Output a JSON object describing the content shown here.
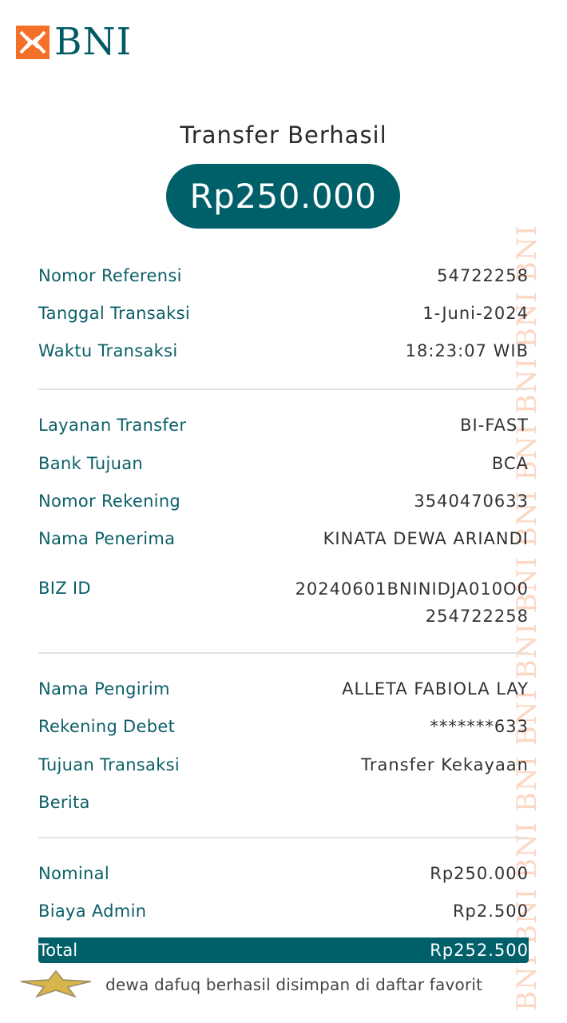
{
  "header": {
    "logo_text": "BNI"
  },
  "watermark": {
    "text": "BNI BNI BNI BNI BNI BNI BNI BNI BNI BNI BNI BNI"
  },
  "title": "Transfer Berhasil",
  "amount": "Rp250.000",
  "sections": {
    "transaction": [
      {
        "label": "Nomor Referensi",
        "value": "54722258"
      },
      {
        "label": "Tanggal Transaksi",
        "value": "1-Juni-2024"
      },
      {
        "label": "Waktu Transaksi",
        "value": "18:23:07 WIB"
      }
    ],
    "recipient": [
      {
        "label": "Layanan Transfer",
        "value": "BI-FAST"
      },
      {
        "label": "Bank Tujuan",
        "value": "BCA"
      },
      {
        "label": "Nomor Rekening",
        "value": "3540470633"
      },
      {
        "label": "Nama Penerima",
        "value": "KINATA DEWA ARIANDI"
      },
      {
        "label": "BIZ ID",
        "value_line1": "20240601BNINIDJA010O0",
        "value_line2": "254722258"
      }
    ],
    "sender": [
      {
        "label": "Nama Pengirim",
        "value": "ALLETA FABIOLA LAY"
      },
      {
        "label": "Rekening Debet",
        "value": "*******633"
      },
      {
        "label": "Tujuan Transaksi",
        "value": "Transfer Kekayaan"
      },
      {
        "label": "Berita",
        "value": ""
      }
    ],
    "summary": [
      {
        "label": "Nominal",
        "value": "Rp250.000"
      },
      {
        "label": "Biaya Admin",
        "value": "Rp2.500"
      }
    ]
  },
  "total": {
    "label": "Total",
    "value": "Rp252.500"
  },
  "favorite": {
    "icon": "star-icon",
    "message": "dewa dafuq berhasil disimpan di daftar favorit"
  },
  "colors": {
    "brand_teal": "#00606a",
    "brand_orange": "#f47028",
    "label_teal": "#0b5f68"
  }
}
